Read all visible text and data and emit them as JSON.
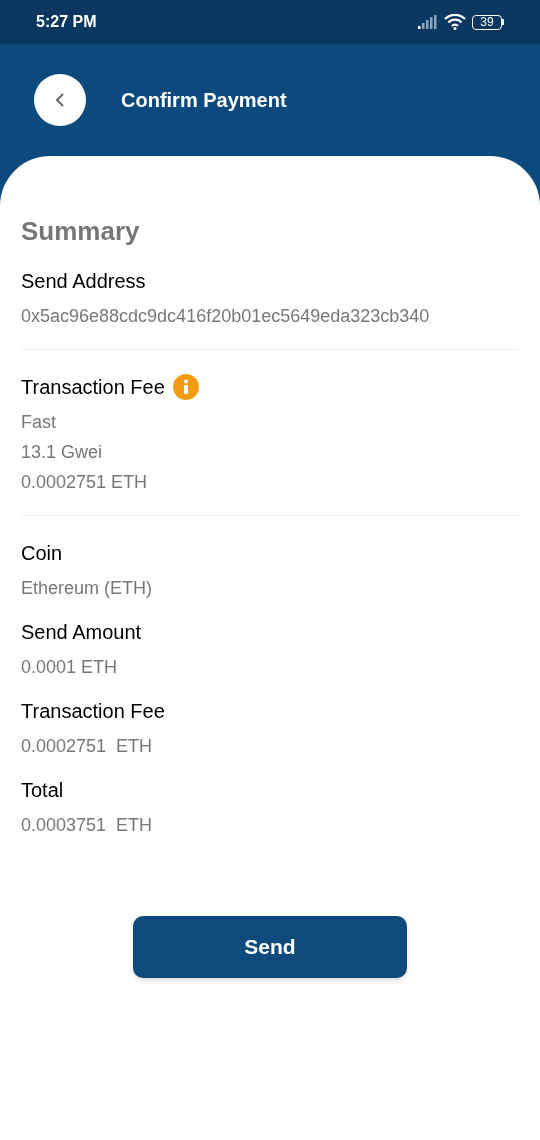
{
  "status_bar": {
    "time": "5:27 PM",
    "battery": "39"
  },
  "header": {
    "title": "Confirm Payment"
  },
  "summary": {
    "title": "Summary",
    "sections": [
      {
        "label": "Send Address",
        "info": false,
        "divider_after": true,
        "values": [
          "0x5ac96e88cdc9dc416f20b01ec5649eda323cb340"
        ]
      },
      {
        "label": "Transaction Fee",
        "info": true,
        "divider_after": true,
        "values": [
          "Fast",
          "13.1 Gwei",
          "0.0002751 ETH"
        ]
      },
      {
        "label": "Coin",
        "info": false,
        "divider_after": false,
        "values": [
          "Ethereum (ETH)"
        ]
      },
      {
        "label": "Send Amount",
        "info": false,
        "divider_after": false,
        "values": [
          "0.0001 ETH"
        ]
      },
      {
        "label": "Transaction Fee",
        "info": false,
        "divider_after": false,
        "values": [
          "0.0002751  ETH"
        ]
      },
      {
        "label": "Total",
        "info": false,
        "divider_after": false,
        "values": [
          "0.0003751  ETH"
        ]
      }
    ]
  },
  "send_button": "Send"
}
